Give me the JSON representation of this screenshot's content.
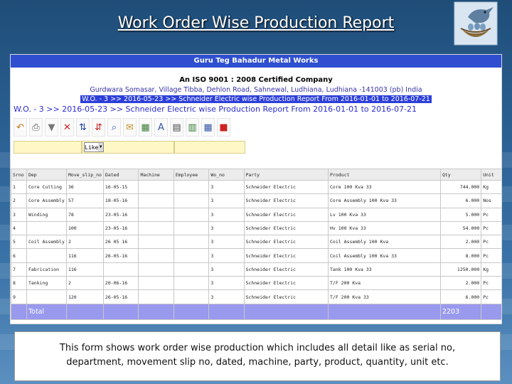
{
  "slide": {
    "title": "Work Order Wise Production Report",
    "caption_line1": "This form shows work order wise production which includes all detail like as serial no,",
    "caption_line2": "department, movement slip no, dated, machine, party, product, quantity, unit etc."
  },
  "report": {
    "company": "Guru Teg Bahadur Metal Works",
    "certification": "An ISO 9001 : 2008 Certified Company",
    "address": "Gurdwara Somasar, Village Tibba, Dehlon Road, Sahnewal, Ludhiana, Ludhiana -141003 (pb) India",
    "selection": "W.O. - 3 >> 2016-05-23 >> Schneider Electric wise Production Report From 2016-01-01 to 2016-07-21",
    "subtitle": "W.O. - 3 >> 2016-05-23 >> Schneider Electric wise Production Report From 2016-01-01 to 2016-07-21",
    "filter_value": "Like"
  },
  "toolbar": [
    {
      "name": "refresh-icon",
      "glyph": "↶",
      "color": "#c47a1a"
    },
    {
      "name": "print-icon",
      "glyph": "⎙",
      "color": "#555555"
    },
    {
      "name": "filter-icon",
      "glyph": "▼",
      "color": "#777777"
    },
    {
      "name": "clear-filter-icon",
      "glyph": "✕",
      "color": "#cc2222"
    },
    {
      "name": "sort-ascending-icon",
      "glyph": "⇅",
      "color": "#2244aa"
    },
    {
      "name": "sort-descending-icon",
      "glyph": "⇵",
      "color": "#cc2222"
    },
    {
      "name": "search-icon",
      "glyph": "⌕",
      "color": "#2b5fa8"
    },
    {
      "name": "email-icon",
      "glyph": "✉",
      "color": "#c4942a"
    },
    {
      "name": "grid-view-icon",
      "glyph": "▦",
      "color": "#3a7a3a"
    },
    {
      "name": "font-icon",
      "glyph": "A",
      "color": "#3355aa"
    },
    {
      "name": "document-icon",
      "glyph": "▤",
      "color": "#444444"
    },
    {
      "name": "spreadsheet-icon",
      "glyph": "▥",
      "color": "#2a7a2a"
    },
    {
      "name": "table-icon",
      "glyph": "▦",
      "color": "#3355aa"
    },
    {
      "name": "pdf-icon",
      "glyph": "■",
      "color": "#cc2222"
    }
  ],
  "table": {
    "headers": [
      "Srno",
      "Dep",
      "Move_slip_no",
      "Dated",
      "Machine",
      "Employee",
      "Wo_no",
      "Party",
      "Product",
      "Qty",
      "Unit"
    ],
    "rows": [
      [
        "1",
        "Core Cutting",
        "36",
        "16-05-15",
        "",
        "",
        "3",
        "Schneider Electric",
        "Core 100 Kva 33",
        "744.000",
        "Kg"
      ],
      [
        "2",
        "Core Assembly",
        "57",
        "18-05-16",
        "",
        "",
        "3",
        "Schneider Electric",
        "Core Assembly 100 Kva 33",
        "6.000",
        "Nos"
      ],
      [
        "3",
        "Winding",
        "78",
        "23-05-16",
        "",
        "",
        "3",
        "Schneider Electric",
        "Lv 100 Kva 33",
        "5.000",
        "Pc"
      ],
      [
        "4",
        "",
        "100",
        "23-05-16",
        "",
        "",
        "3",
        "Schneider Electric",
        "Hv 100 Kva 33",
        "54.000",
        "Pc"
      ],
      [
        "5",
        "Coil Assembly",
        "2",
        "26 05 16",
        "",
        "",
        "3",
        "Schneider Electric",
        "Coil Assembly 100 Kva",
        "2.000",
        "Pc"
      ],
      [
        "6",
        "",
        "116",
        "26-05-16",
        "",
        "",
        "3",
        "Schneider Electric",
        "Coil Assembly 100 Kva 33",
        "8.000",
        "Pc"
      ],
      [
        "7",
        "Fabrication",
        "116",
        "",
        "",
        "",
        "3",
        "Schneider Electric",
        "Tank 100 Kva 33",
        "1250.000",
        "Kg"
      ],
      [
        "8",
        "Tanking",
        "2",
        "20-06-16",
        "",
        "",
        "3",
        "Schneider Electric",
        "T/F 200 Kva",
        "2.000",
        "Pc"
      ],
      [
        "9",
        "",
        "120",
        "26-05-16",
        "",
        "",
        "3",
        "Schneider Electric",
        "T/F 200 Kva 33",
        "6.000",
        "Pc"
      ]
    ],
    "total_label": "Total",
    "total_value": "2203"
  }
}
